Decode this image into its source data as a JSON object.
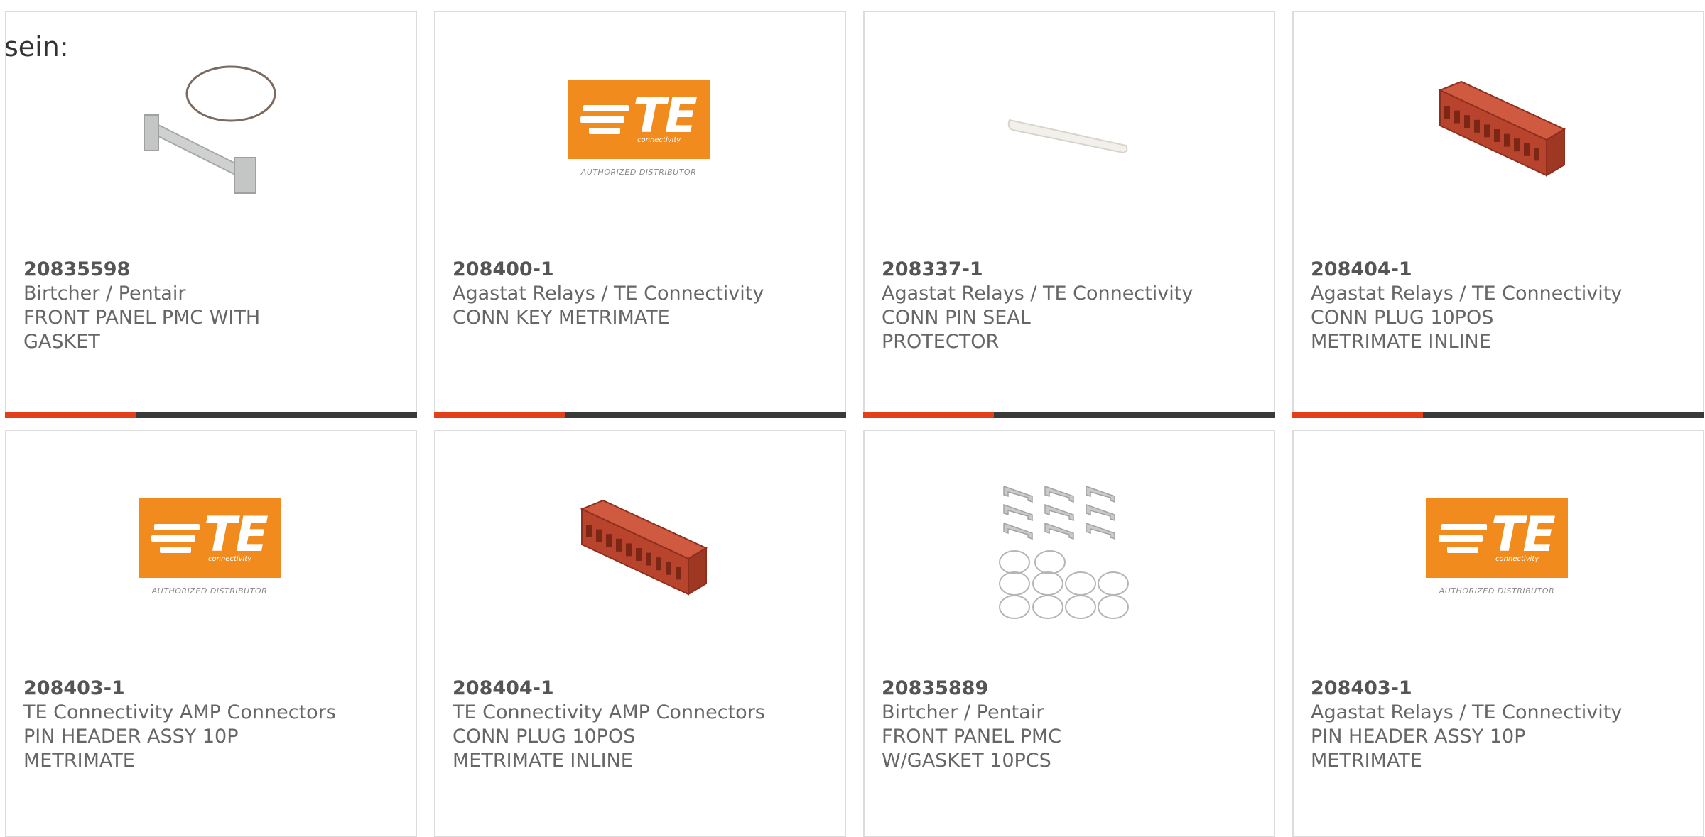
{
  "intro_text": "sein:",
  "colors": {
    "accent_bar": "#e2401b",
    "bar_dark": "#3a3a3a",
    "te_orange": "#f28b1d"
  },
  "logo_text": {
    "mark": "TE",
    "sub": "connectivity",
    "authorized": "AUTHORIZED DISTRIBUTOR"
  },
  "products": [
    {
      "part_number": "20835598",
      "manufacturer": "Birtcher / Pentair",
      "description": "FRONT PANEL PMC WITH GASKET",
      "image": "front-panel-gasket-image",
      "show_bar": true
    },
    {
      "part_number": "208400-1",
      "manufacturer": "Agastat Relays / TE Connectivity",
      "description": "CONN KEY METRIMATE",
      "image": "te-authorized-distributor-logo",
      "show_bar": true
    },
    {
      "part_number": "208337-1",
      "manufacturer": "Agastat Relays / TE Connectivity",
      "description": "CONN PIN SEAL PROTECTOR",
      "image": "pin-seal-protector-image",
      "show_bar": true
    },
    {
      "part_number": "208404-1",
      "manufacturer": "Agastat Relays / TE Connectivity",
      "description": "CONN PLUG 10POS METRIMATE INLINE",
      "image": "red-connector-plug-image",
      "show_bar": true
    },
    {
      "part_number": "208403-1",
      "manufacturer": "TE Connectivity AMP Connectors",
      "description": "PIN HEADER ASSY 10P METRIMATE",
      "image": "te-authorized-distributor-logo",
      "show_bar": false
    },
    {
      "part_number": "208404-1",
      "manufacturer": "TE Connectivity AMP Connectors",
      "description": "CONN PLUG 10POS METRIMATE INLINE",
      "image": "red-connector-plug-image",
      "show_bar": false
    },
    {
      "part_number": "20835889",
      "manufacturer": "Birtcher / Pentair",
      "description": "FRONT PANEL PMC W/GASKET 10PCS",
      "image": "front-panel-gasket-10pcs-image",
      "show_bar": false
    },
    {
      "part_number": "208403-1",
      "manufacturer": "Agastat Relays / TE Connectivity",
      "description": "PIN HEADER ASSY 10P METRIMATE",
      "image": "te-authorized-distributor-logo",
      "show_bar": false
    }
  ]
}
